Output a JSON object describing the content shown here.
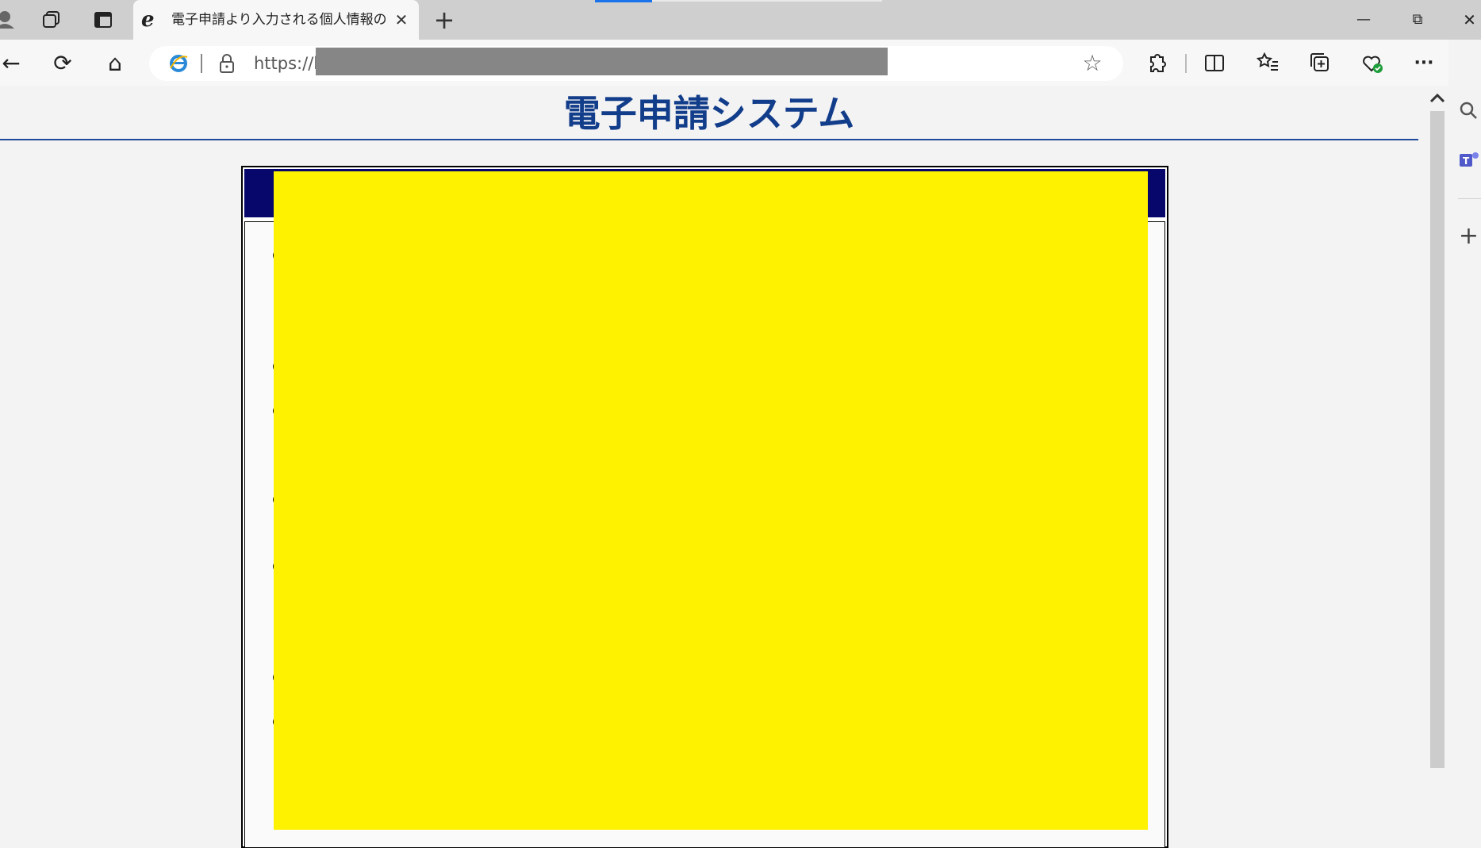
{
  "browser": {
    "tab": {
      "title": "電子申請より入力される個人情報の",
      "close_glyph": "✕"
    },
    "new_tab_glyph": "+",
    "window_controls": {
      "minimize": "—",
      "restore": "⧉",
      "close": "✕"
    },
    "toolbar": {
      "back": "←",
      "refresh": "⟳",
      "home": "⌂",
      "url_visible": "https://l",
      "favorite": "☆",
      "more": "···"
    }
  },
  "page": {
    "title": "電子申請システム"
  },
  "colors": {
    "title": "#123d8a",
    "header_band": "#06066b",
    "highlight": "#fff200",
    "redaction": "#868686"
  }
}
